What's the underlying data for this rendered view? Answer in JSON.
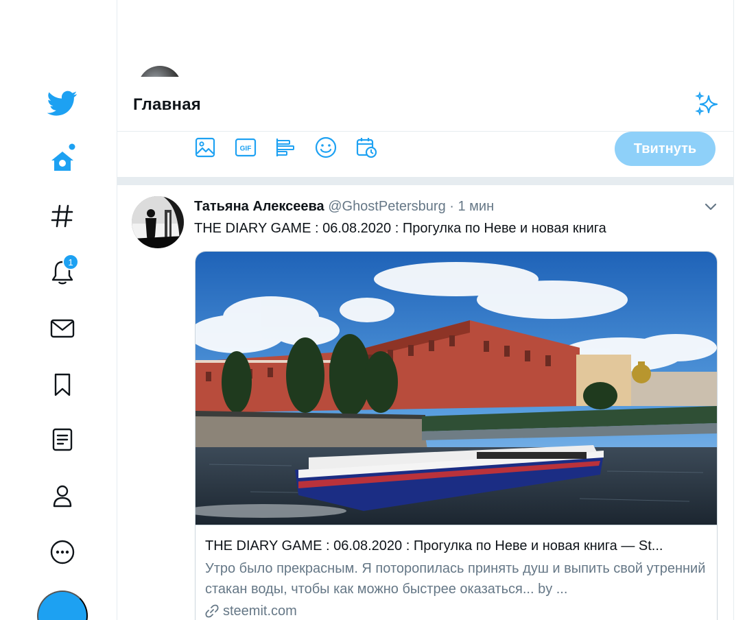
{
  "nav": {
    "notifications_badge": "1"
  },
  "header": {
    "title": "Главная"
  },
  "composer": {
    "tweet_button_label": "Твитнуть",
    "gif_label": "GIF"
  },
  "tweet": {
    "author_name": "Татьяна Алексеева",
    "author_handle": "@GhostPetersburg",
    "separator": "·",
    "time": "1 мин",
    "text": "THE DIARY GAME : 06.08.2020 : Прогулка по Неве и новая книга",
    "card": {
      "title": "THE DIARY GAME : 06.08.2020 : Прогулка по Неве и новая книга — St...",
      "description": "Утро было прекрасным. Я поторопилась принять душ и выпить свой утренний стакан воды, чтобы как можно быстрее оказаться... by ...",
      "domain": "steemit.com"
    }
  },
  "colors": {
    "accent": "#1da1f2",
    "tweet_button_disabled": "#8ed0f9",
    "secondary_text": "#657786",
    "border": "#e6ecf0"
  }
}
